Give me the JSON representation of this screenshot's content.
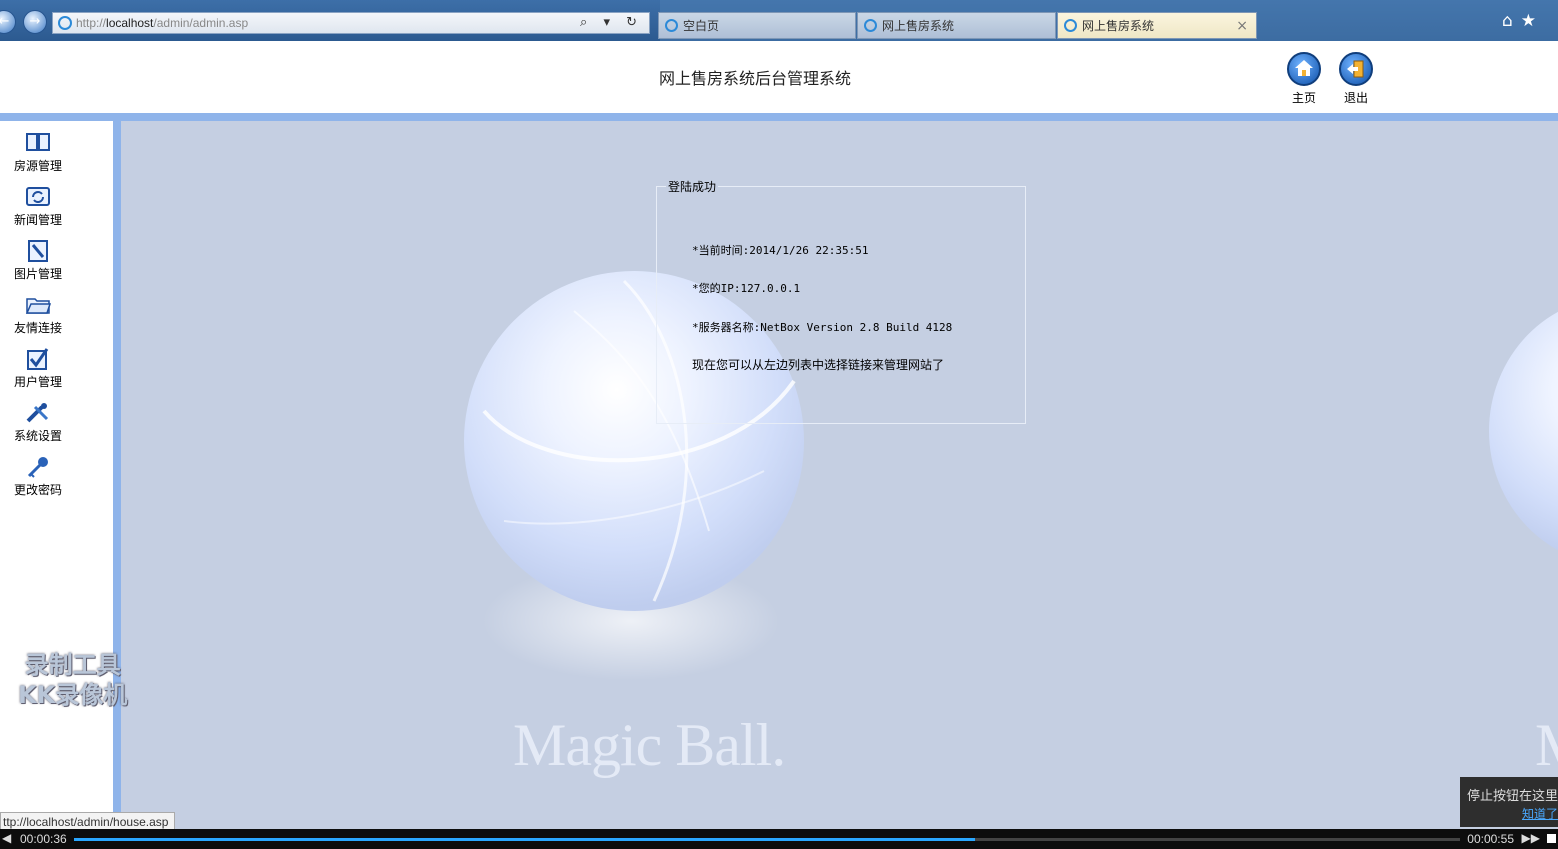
{
  "browser": {
    "url_prefix": "http://",
    "url_host": "localhost",
    "url_path": "/admin/admin.asp",
    "address_controls": "⌕ ▾ ↻",
    "tabs": [
      {
        "label": "空白页"
      },
      {
        "label": "网上售房系统"
      },
      {
        "label": "网上售房系统"
      }
    ],
    "close_tab": "×",
    "home_icon": "⌂",
    "fav_icon": "★"
  },
  "header": {
    "title": "网上售房系统后台管理系统",
    "home_label": "主页",
    "logout_label": "退出"
  },
  "sidebar": {
    "items": [
      {
        "label": "房源管理",
        "icon": "book-icon"
      },
      {
        "label": "新闻管理",
        "icon": "refresh-icon"
      },
      {
        "label": "图片管理",
        "icon": "edit-icon"
      },
      {
        "label": "友情连接",
        "icon": "folder-icon"
      },
      {
        "label": "用户管理",
        "icon": "check-icon"
      },
      {
        "label": "系统设置",
        "icon": "tools-icon"
      },
      {
        "label": "更改密码",
        "icon": "key-icon"
      }
    ]
  },
  "main": {
    "legend": "登陆成功",
    "time": "*当前时间:2014/1/26 22:35:51",
    "ip": "*您的IP:127.0.0.1",
    "server": "*服务器名称:NetBox Version 2.8 Build 4128",
    "hint": "现在您可以从左边列表中选择链接来管理网站了",
    "brand": "Magic Ball.",
    "brand_right": "M"
  },
  "watermark": {
    "line1": "录制工具",
    "line2": "KK录像机"
  },
  "status": {
    "url": "ttp://localhost/admin/house.asp"
  },
  "player": {
    "elapsed": "00:00:36",
    "total": "00:00:55",
    "progress": 0.65,
    "tip_text": "停止按钮在这里",
    "tip_link": "知道了"
  }
}
